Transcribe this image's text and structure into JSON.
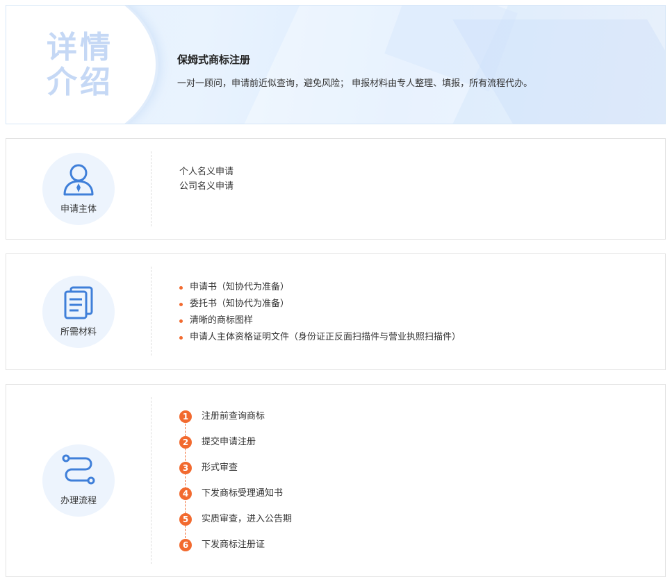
{
  "header": {
    "big_title_line1": "详情",
    "big_title_line2": "介绍",
    "service_title": "保姆式商标注册",
    "service_desc": "一对一顾问，申请前近似查询，避免风险； 申报材料由专人整理、填报，所有流程代办。"
  },
  "sections": {
    "applicant": {
      "label": "申请主体",
      "icon": "person-icon",
      "items": [
        "个人名义申请",
        "公司名义申请"
      ]
    },
    "materials": {
      "label": "所需材料",
      "icon": "documents-icon",
      "items": [
        "申请书（知协代为准备）",
        "委托书（知协代为准备）",
        "清晰的商标图样",
        "申请人主体资格证明文件（身份证正反面扫描件与营业执照扫描件）"
      ]
    },
    "process": {
      "label": "办理流程",
      "icon": "flow-icon",
      "steps": [
        {
          "num": "1",
          "label": "注册前查询商标"
        },
        {
          "num": "2",
          "label": "提交申请注册"
        },
        {
          "num": "3",
          "label": "形式审查"
        },
        {
          "num": "4",
          "label": "下发商标受理通知书"
        },
        {
          "num": "5",
          "label": "实质审查，进入公告期"
        },
        {
          "num": "6",
          "label": "下发商标注册证"
        }
      ]
    }
  },
  "colors": {
    "accent_orange": "#f26a2f",
    "icon_blue": "#3f7fd9",
    "title_faded_blue": "#c5d8f5"
  }
}
